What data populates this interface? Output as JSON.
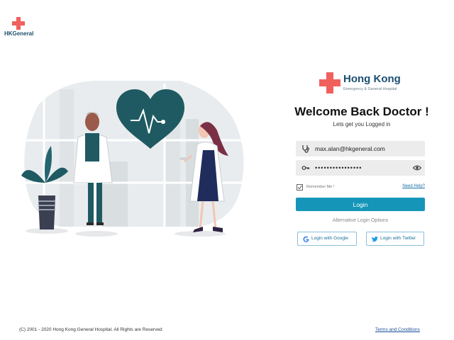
{
  "header": {
    "logo_name": "HKGeneral"
  },
  "brand": {
    "title": "Hong Kong",
    "subtitle": "Emergency & General Hospital"
  },
  "login": {
    "heading": "Welcome Back Doctor !",
    "tagline": "Lets get you Logged in",
    "email_value": "max.alan@hkgeneral.com",
    "password_value": "••••••••••••••••",
    "remember_label": "Remember Me !",
    "help_label": "Need Help?",
    "submit_label": "Login",
    "alt_label": "Alternative Login Options",
    "google_label": "Login with Google",
    "twitter_label": "Login with Twitter"
  },
  "footer": {
    "copyright": "(C) 2001 - 2020 Hong Kong General Hospital. All Rights are Reserved",
    "terms_label": "Terms and Conditions"
  },
  "colors": {
    "brand_red": "#f0605d",
    "brand_navy": "#1b4f70",
    "primary": "#1596b9",
    "heart": "#1f5a63"
  },
  "icons": {
    "logo": "medical-cross-icon",
    "email": "stethoscope-icon",
    "password": "key-icon",
    "reveal": "eye-icon",
    "remember": "checkbox-checked-icon",
    "google": "google-icon",
    "twitter": "twitter-icon"
  }
}
